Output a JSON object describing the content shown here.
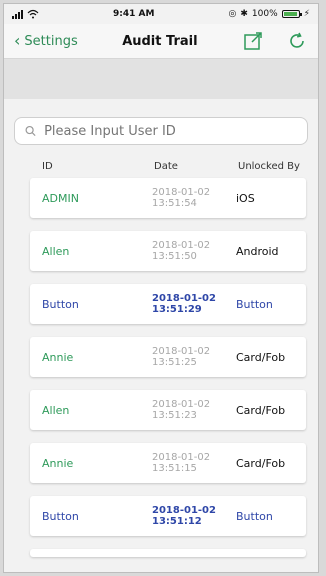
{
  "status": {
    "time": "9:41 AM",
    "battery": "100%"
  },
  "nav": {
    "back_label": "Settings",
    "title": "Audit Trail"
  },
  "search": {
    "placeholder": "Please Input User ID",
    "value": ""
  },
  "table": {
    "headers": [
      "ID",
      "Date",
      "Unlocked By"
    ],
    "rows": [
      {
        "id": "ADMIN",
        "date_line1": "2018-01-02",
        "date_line2": "13:51:54",
        "by": "iOS",
        "style": "normal"
      },
      {
        "id": "Allen",
        "date_line1": "2018-01-02",
        "date_line2": "13:51:50",
        "by": "Android",
        "style": "normal"
      },
      {
        "id": "Button",
        "date_line1": "2018-01-02",
        "date_line2": "13:51:29",
        "by": "Button",
        "style": "blue"
      },
      {
        "id": "Annie",
        "date_line1": "2018-01-02",
        "date_line2": "13:51:25",
        "by": "Card/Fob",
        "style": "normal"
      },
      {
        "id": "Allen",
        "date_line1": "2018-01-02",
        "date_line2": "13:51:23",
        "by": "Card/Fob",
        "style": "normal"
      },
      {
        "id": "Annie",
        "date_line1": "2018-01-02",
        "date_line2": "13:51:15",
        "by": "Card/Fob",
        "style": "normal"
      },
      {
        "id": "Button",
        "date_line1": "2018-01-02",
        "date_line2": "13:51:12",
        "by": "Button",
        "style": "blue"
      }
    ]
  },
  "colors": {
    "green": "#2e9a5a",
    "blue": "#2f47a8"
  }
}
